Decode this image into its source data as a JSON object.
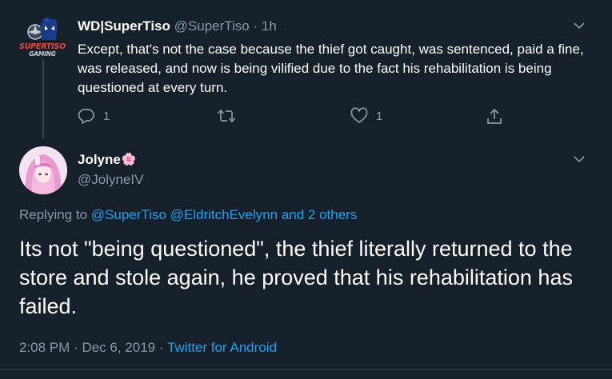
{
  "tweet1": {
    "display_name": "WD|SuperTiso",
    "handle": "@SuperTiso",
    "separator": "·",
    "time": "1h",
    "text": "Except, that's not the case because the thief got caught, was sentenced, paid a fine, was released, and now is being vilified due to the fact his rehabilitation is being questioned at every turn.",
    "avatar_text_line1": "SUPERTISO",
    "avatar_text_line2": "GAMING",
    "reply_count": "1",
    "like_count": "1",
    "icons": [
      "reply-icon",
      "retweet-icon",
      "like-icon",
      "share-icon",
      "chevron-down-icon"
    ]
  },
  "tweet2": {
    "display_name": "Jolyne",
    "name_emoji": "🌸",
    "handle": "@JolyneIV",
    "replying_prefix": "Replying to",
    "replying_user1": "@SuperTiso",
    "replying_user2": "@EldritchEvelynn",
    "replying_others": "and 2 others",
    "text": "Its not \"being questioned\", the thief literally returned to the store and stole again, he proved that his rehabilitation has failed.",
    "time": "2:08 PM",
    "date": "Dec 6, 2019",
    "meta_separator": "·",
    "source": "Twitter for Android"
  },
  "colors": {
    "background": "#15202b",
    "secondary_text": "#8899a6",
    "link": "#1da1f2",
    "divider": "#38444d"
  }
}
